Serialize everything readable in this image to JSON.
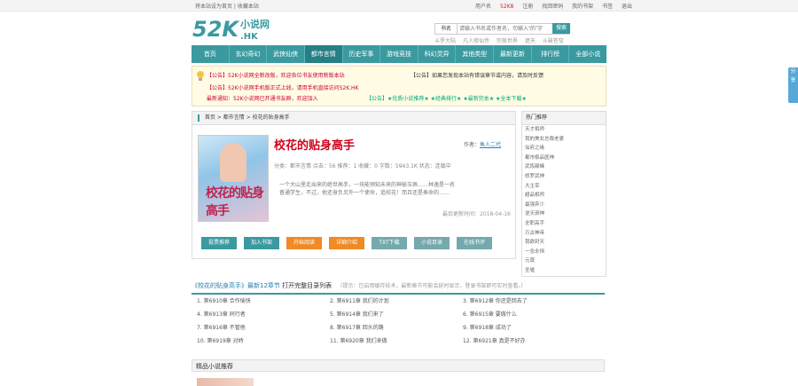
{
  "topbar": {
    "left": "将本站设为首页 | 收藏本站",
    "items": [
      "用户名",
      "52K8",
      "注册",
      "找回密码",
      "我的书架",
      "书签",
      "退出"
    ]
  },
  "logo": {
    "text": "52K小说网",
    "sub": ".HK"
  },
  "search": {
    "select": "书名",
    "placeholder": "请输入书名或作者名，勿输入“的”字",
    "button": "搜索"
  },
  "hot_searches": [
    "斗罗大陆",
    "凡人修仙传",
    "完美世界",
    "遮天",
    "斗破苍穹"
  ],
  "nav": [
    "首页",
    "玄幻奇幻",
    "武侠仙侠",
    "都市言情",
    "历史军事",
    "游戏竞技",
    "科幻灵异",
    "其他类型",
    "最新更新",
    "排行榜",
    "全部小说"
  ],
  "notices": [
    "【公告】52K小说网全新改版，欢迎各位书友使用新版本站",
    "【公告】52K小说网手机版正式上线，请用手机直接访问52K.HK",
    "最新通知：52K小说网已开通书友群，欢迎加入",
    "【公告】如果您发现本站有错误章节或内容，请及时反馈",
    "【公告】★优质小说推荐★  ★经典排行★  ★最新完本★  ★全本下载★"
  ],
  "breadcrumb": [
    "首页",
    "都市言情",
    "校花的贴身高手"
  ],
  "book": {
    "title": "校花的贴身高手",
    "author_label": "作者：",
    "author": "鱼人二代",
    "meta": "分类：都市言情    点击：56    推荐：1    收藏：0    字数：5943.1K    状态：连载中",
    "intro": "一个大山里走出来的绝世高手，一块能预知未来的神秘玉佩……林逸是一名普通学生，不过，他还身负另外一个使命，追校花！而且还是奉命的……",
    "update": "最后更新时间：2018-04-16",
    "cover_title": "校花的贴身高手"
  },
  "book_buttons": [
    "投票推荐",
    "加入书架",
    "开始阅读",
    "详细介绍",
    "TXT下载",
    "小说目录",
    "在线书评"
  ],
  "hot_list": {
    "title": "热门推荐",
    "items": [
      "天才相师",
      "我的美女总裁老婆",
      "仙府之缘",
      "都市极品医神",
      "武炼巅峰",
      "修罗武神",
      "大主宰",
      "超品相师",
      "最强弃少",
      "逆天邪神",
      "全职高手",
      "万古神帝",
      "我欲封天",
      "一念永恒",
      "元尊",
      "圣墟"
    ]
  },
  "chapters": {
    "heading": "《校花的贴身高手》最新12章节",
    "link": "打开完整目录列表",
    "tip": "（提示：已启用缓存技术，最新章节可能会延时显示，登录书架即可实时查看。）",
    "items": [
      "1. 第6910章 合作愉快",
      "2. 第6911章 我们的计划",
      "3. 第6912章 你还是回去了",
      "4. 第6913章 同行者",
      "5. 第6914章 我们来了",
      "6. 第6915章 要做什么",
      "7. 第6916章 不管他",
      "8. 第6917章 回头的路",
      "9. 第6918章 成功了",
      "10. 第6919章 对峙",
      "11. 第6920章 我们来做",
      "12. 第6921章 真是不好办"
    ]
  },
  "recommend_title": "精品小说推荐",
  "share": "分享"
}
